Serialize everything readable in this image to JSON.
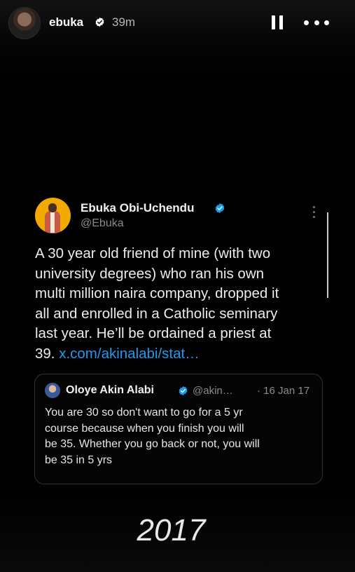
{
  "story": {
    "username": "ebuka",
    "time_ago": "39m"
  },
  "tweet": {
    "author_name": "Ebuka Obi-Uchendu",
    "author_handle": "@Ebuka",
    "text_lines": [
      "A 30 year old friend of mine (with two",
      "university degrees) who ran his own",
      "multi million naira company, dropped it",
      "all and enrolled in a Catholic seminary",
      "last year. He’ll be ordained a priest at",
      "39."
    ],
    "link": "x.com/akinalabi/stat…"
  },
  "quoted_tweet": {
    "author_name": "Oloye Akin Alabi",
    "author_handle": "@akin…",
    "date": "· 16 Jan 17",
    "text_lines": [
      "You are 30 so don't want to go for a 5 yr",
      "course because when you finish you will",
      "be 35. Whether you go back or not, you will",
      "be 35 in 5 yrs"
    ]
  },
  "caption": "2017",
  "colors": {
    "background": "#000000",
    "link": "#1d9bf0",
    "verified_badge": "#1d9bf0",
    "secondary_text": "#8b8b8b",
    "avatar_bg": "#f2a900"
  },
  "icons": [
    "verified-badge-icon",
    "pause-icon",
    "more-options-icon",
    "tweet-more-icon"
  ]
}
